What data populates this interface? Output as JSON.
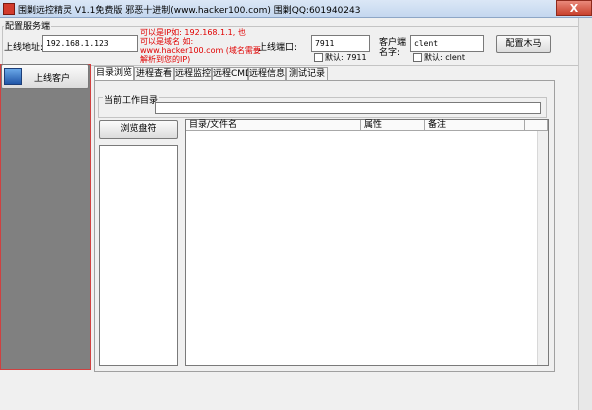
{
  "window": {
    "title": "围剿远控精灵 V1.1免费版    邪恶十进制(www.hacker100.com)    围剿QQ:601940243",
    "close_label": "X"
  },
  "config": {
    "group_title": "配置服务端",
    "online_address_label": "上线地址:",
    "online_address_value": "192.168.1.123",
    "note_lines": [
      "可以是IP如: 192.168.1.1, 也",
      "可以是域名 如:",
      "www.hacker100.com (域名需要",
      "解析到您的IP)"
    ],
    "port_label": "上线端口:",
    "port_value": "7911",
    "port_default_label": "默认: 7911",
    "client_name_label_line1": "客户端",
    "client_name_label_line2": "名字:",
    "client_name_value": "clent",
    "client_default_label": "默认: clent",
    "configure_button_label": "配置木马"
  },
  "left_panel": {
    "online_clients_label": "上线客户"
  },
  "tabs": [
    {
      "label": "目录浏览",
      "active": true
    },
    {
      "label": "进程查看",
      "active": false
    },
    {
      "label": "远程监控",
      "active": false
    },
    {
      "label": "远程CMD",
      "active": false
    },
    {
      "label": "远程信息",
      "active": false
    },
    {
      "label": "测试记录",
      "active": false
    }
  ],
  "browser": {
    "cwd_label": "当前工作目录",
    "cwd_value": "",
    "browse_drives_label": "浏览盘符",
    "columns": [
      "目录/文件名",
      "属性",
      "备注"
    ]
  },
  "colors": {
    "note_red": "#e00000",
    "left_panel_gray": "#808080",
    "left_panel_border": "#d04040"
  }
}
